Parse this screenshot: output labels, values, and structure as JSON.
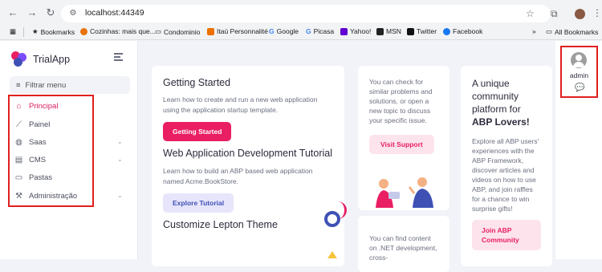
{
  "browser": {
    "url": "localhost:44349",
    "bookmarks": [
      {
        "label": "Bookmarks",
        "icon": "star-icon"
      },
      {
        "label": "Cozinhas: mais que...",
        "icon": "site-icon"
      },
      {
        "label": "Condominio",
        "icon": "folder-icon"
      },
      {
        "label": "Itaú Personnalité",
        "icon": "site-icon"
      },
      {
        "label": "Google",
        "icon": "google-icon"
      },
      {
        "label": "Picasa",
        "icon": "google-icon"
      },
      {
        "label": "Yahoo!",
        "icon": "yahoo-icon"
      },
      {
        "label": "MSN",
        "icon": "msn-icon"
      },
      {
        "label": "Twitter",
        "icon": "x-icon"
      },
      {
        "label": "Facebook",
        "icon": "facebook-icon"
      }
    ],
    "overflow": "»",
    "all_bookmarks": "All Bookmarks"
  },
  "sidebar": {
    "brand": "TrialApp",
    "filter_placeholder": "Filtrar menu",
    "items": [
      {
        "label": "Principal",
        "icon": "home-icon",
        "active": true,
        "chevron": false
      },
      {
        "label": "Painel",
        "icon": "chart-icon",
        "active": false,
        "chevron": false
      },
      {
        "label": "Saas",
        "icon": "globe-icon",
        "active": false,
        "chevron": true
      },
      {
        "label": "CMS",
        "icon": "list-icon",
        "active": false,
        "chevron": true
      },
      {
        "label": "Pastas",
        "icon": "folder-icon",
        "active": false,
        "chevron": false
      },
      {
        "label": "Administração",
        "icon": "wrench-icon",
        "active": false,
        "chevron": true
      }
    ]
  },
  "main": {
    "getting_started": {
      "title": "Getting Started",
      "text": "Learn how to create and run a new web application using the application startup template.",
      "button": "Getting Started"
    },
    "tutorial": {
      "title": "Web Application Development Tutorial",
      "text": "Learn how to build an ABP based web application named Acme.BookStore.",
      "button": "Explore Tutorial"
    },
    "customize": {
      "title": "Customize Lepton Theme"
    },
    "support": {
      "text": "You can check for similar problems and solutions, or open a new topic to discuss your specific issue.",
      "button": "Visit Support"
    },
    "community": {
      "title_plain": "A unique community platform for ",
      "title_bold": "ABP Lovers!",
      "text": "Explore all ABP users' experiences with the ABP Framework, discover articles and videos on how to use ABP, and join raffles for a chance to win surprise gifts!",
      "button": "Join ABP Community"
    },
    "dotnet": {
      "text": "You can find content on .NET development, cross-"
    }
  },
  "user": {
    "name": "admin"
  },
  "colors": {
    "accent": "#e91e63",
    "highlight_box": "#e01f1f",
    "indigo": "#3f51b5"
  }
}
